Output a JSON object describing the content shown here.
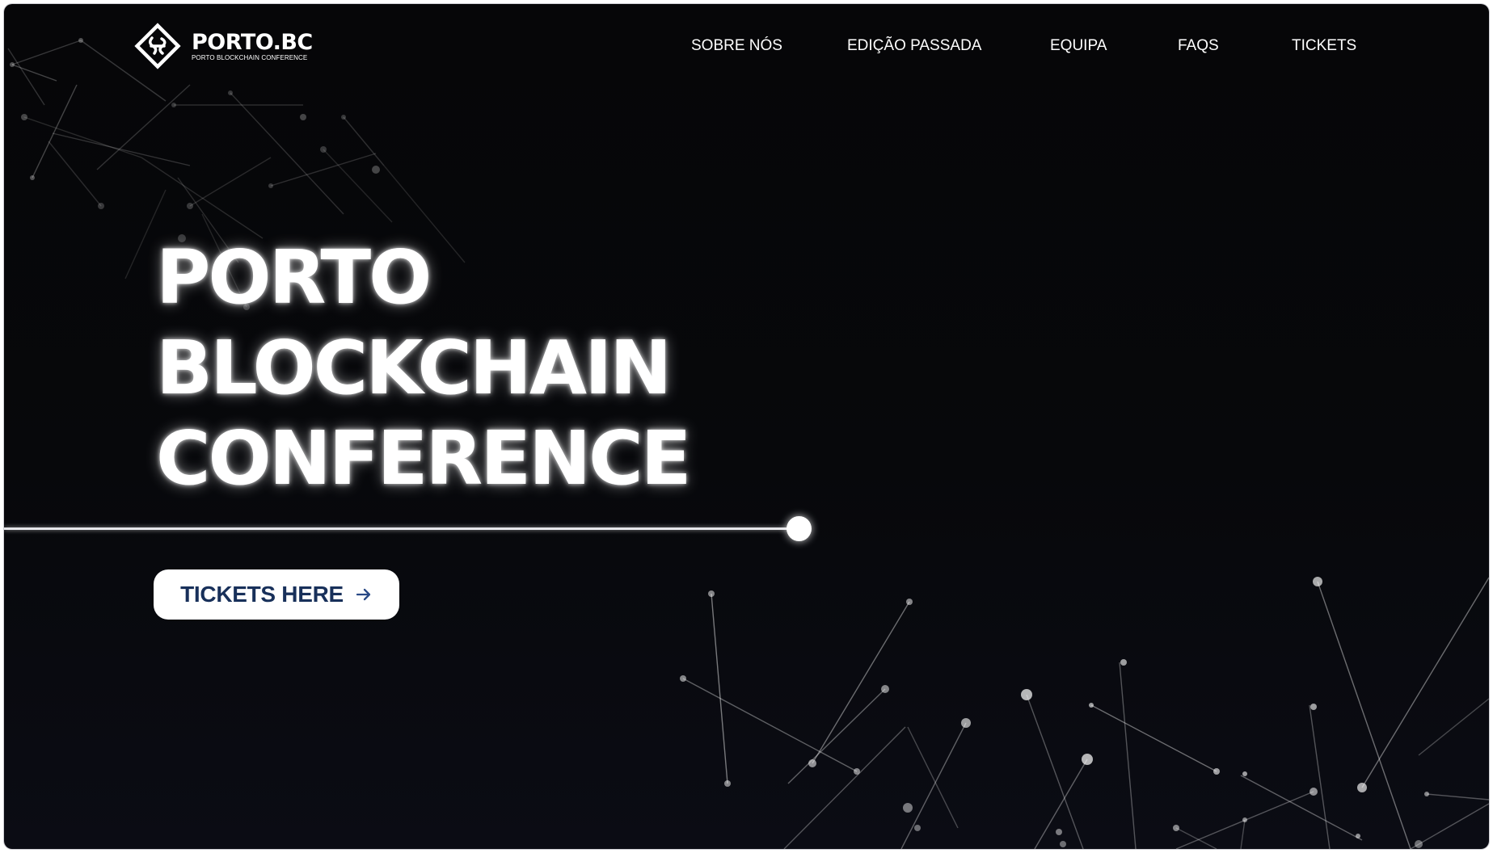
{
  "header": {
    "logo_title": "PORTO.BC",
    "logo_subtitle": "PORTO BLOCKCHAIN CONFERENCE",
    "logo_icon": "diamond-knot-icon"
  },
  "nav": {
    "items": [
      {
        "label": "SOBRE NÓS"
      },
      {
        "label": "EDIÇÃO PASSADA"
      },
      {
        "label": "EQUIPA"
      },
      {
        "label": "FAQS"
      },
      {
        "label": "TICKETS"
      }
    ]
  },
  "hero": {
    "title_lines": [
      "PORTO",
      "BLOCKCHAIN",
      "CONFERENCE"
    ],
    "cta_label": "TICKETS HERE",
    "cta_icon": "arrow-right-icon"
  },
  "colors": {
    "background": "#060608",
    "text": "#ffffff",
    "cta_text": "#18305a",
    "cta_background": "#ffffff"
  }
}
